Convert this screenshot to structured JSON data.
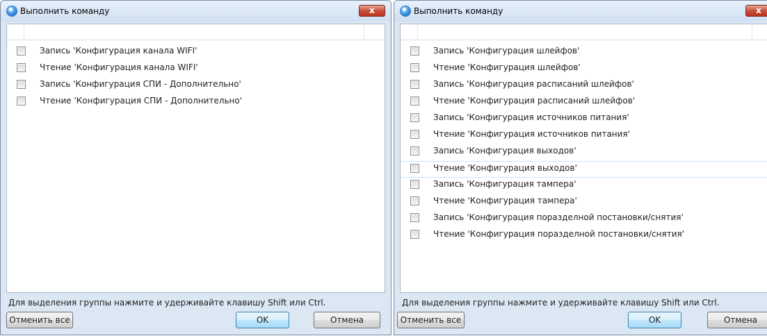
{
  "dialogs": [
    {
      "title": "Выполнить команду",
      "close_label": "x",
      "items": [
        {
          "label": "Запись 'Конфигурация канала WIFI'"
        },
        {
          "label": "Чтение 'Конфигурация канала WIFI'"
        },
        {
          "label": "Запись 'Конфигурация СПИ - Дополнительно'"
        },
        {
          "label": "Чтение 'Конфигурация СПИ - Дополнительно'"
        }
      ],
      "hint": "Для выделения группы нажмите и удерживайте клавишу Shift или Ctrl.",
      "buttons": {
        "cancel_all": "Отменить все",
        "ok": "OK",
        "cancel": "Отмена"
      }
    },
    {
      "title": "Выполнить команду",
      "close_label": "x",
      "items": [
        {
          "label": "Запись 'Конфигурация шлейфов'"
        },
        {
          "label": "Чтение 'Конфигурация шлейфов'"
        },
        {
          "label": "Запись 'Конфигурация расписаний шлейфов'"
        },
        {
          "label": "Чтение 'Конфигурация расписаний шлейфов'"
        },
        {
          "label": "Запись 'Конфигурация источников питания'"
        },
        {
          "label": "Чтение 'Конфигурация источников питания'"
        },
        {
          "label": "Запись 'Конфигурация выходов'"
        },
        {
          "label": "Чтение 'Конфигурация выходов'"
        },
        {
          "label": "Запись 'Конфигурация тампера'"
        },
        {
          "label": "Чтение 'Конфигурация тампера'"
        },
        {
          "label": "Запись 'Конфигурация поразделной постановки/снятия'"
        },
        {
          "label": "Чтение 'Конфигурация поразделной постановки/снятия'"
        }
      ],
      "hint": "Для выделения группы нажмите и удерживайте клавишу Shift или Ctrl.",
      "buttons": {
        "cancel_all": "Отменить все",
        "ok": "OK",
        "cancel": "Отмена"
      }
    }
  ],
  "icons": {
    "app": "app-circle-icon",
    "close": "close-icon",
    "checkbox": "checkbox-unchecked"
  },
  "colors": {
    "title_gradient_top": "#e9f1fb",
    "close_red": "#c8503c",
    "ok_border": "#3c7fb1"
  }
}
